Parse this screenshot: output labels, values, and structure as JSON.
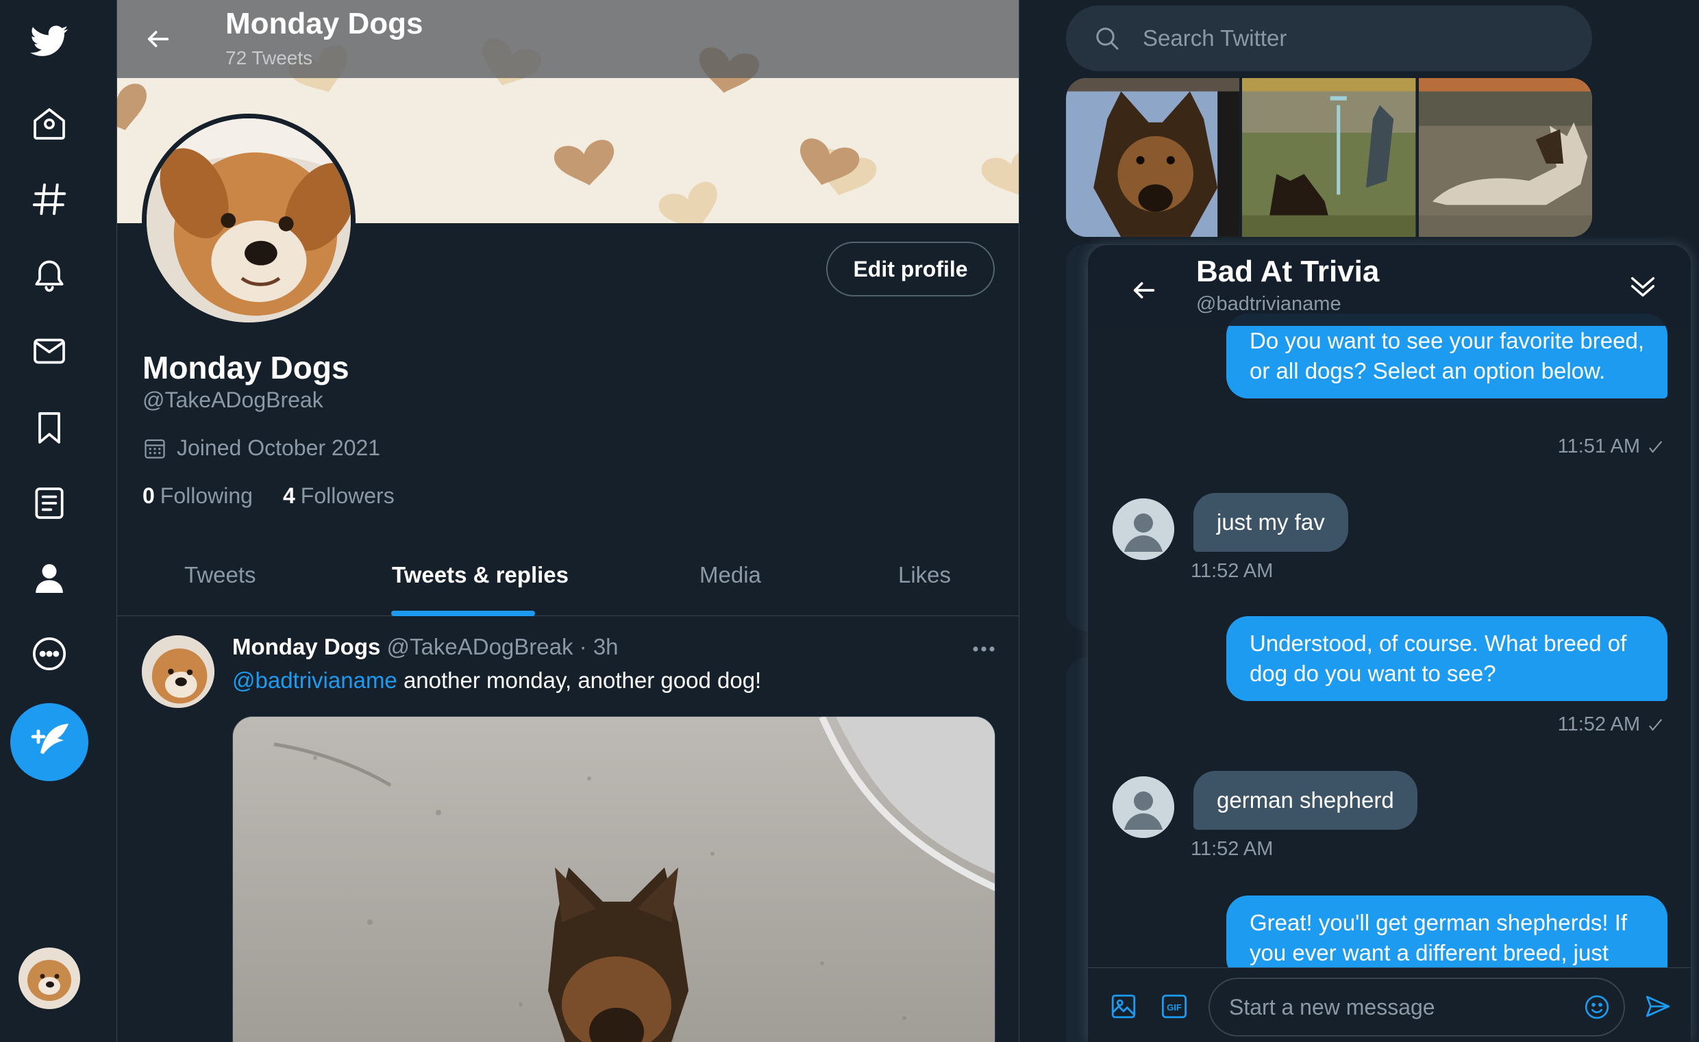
{
  "colors": {
    "background": "#15202b",
    "accent": "#1d9bf0",
    "border": "#38444d",
    "muted_text": "#8b98a5",
    "incoming_bubble": "#3d5466"
  },
  "nav": {
    "icons": [
      "twitter-logo-icon",
      "home-icon",
      "explore-hashtag-icon",
      "notifications-bell-icon",
      "messages-envelope-icon",
      "bookmark-icon",
      "lists-icon",
      "profile-person-icon",
      "more-circle-icon",
      "compose-tweet-icon"
    ]
  },
  "profile": {
    "topbar_title": "Monday Dogs",
    "topbar_subtitle": "72 Tweets",
    "edit_button": "Edit profile",
    "name": "Monday Dogs",
    "handle": "@TakeADogBreak",
    "joined": "Joined October 2021",
    "following_count": "0",
    "following_label": "Following",
    "followers_count": "4",
    "followers_label": "Followers",
    "tabs": [
      {
        "label": "Tweets",
        "active": false
      },
      {
        "label": "Tweets & replies",
        "active": true
      },
      {
        "label": "Media",
        "active": false
      },
      {
        "label": "Likes",
        "active": false
      }
    ]
  },
  "tweet": {
    "author_name": "Monday Dogs",
    "author_handle": "@TakeADogBreak",
    "separator": "·",
    "time": "3h",
    "mention": "@badtrivianame",
    "text": " another monday, another good dog!"
  },
  "search": {
    "placeholder": "Search Twitter"
  },
  "dm": {
    "name": "Bad At Trivia",
    "handle": "@badtrivianame",
    "composer_placeholder": "Start a new message",
    "gif_label": "GIF",
    "messages": [
      {
        "direction": "out",
        "text": "Do you want to see your favorite breed, or all dogs? Select an option below.",
        "time": "11:51 AM"
      },
      {
        "direction": "in",
        "text": "just my fav",
        "time": "11:52 AM"
      },
      {
        "direction": "out",
        "text": "Understood, of course. What breed of dog do you want to see?",
        "time": "11:52 AM"
      },
      {
        "direction": "in",
        "text": "german shepherd",
        "time": "11:52 AM"
      },
      {
        "direction": "out",
        "text": "Great! you'll get german shepherds!  If you ever want a different breed, just",
        "time": ""
      }
    ]
  }
}
